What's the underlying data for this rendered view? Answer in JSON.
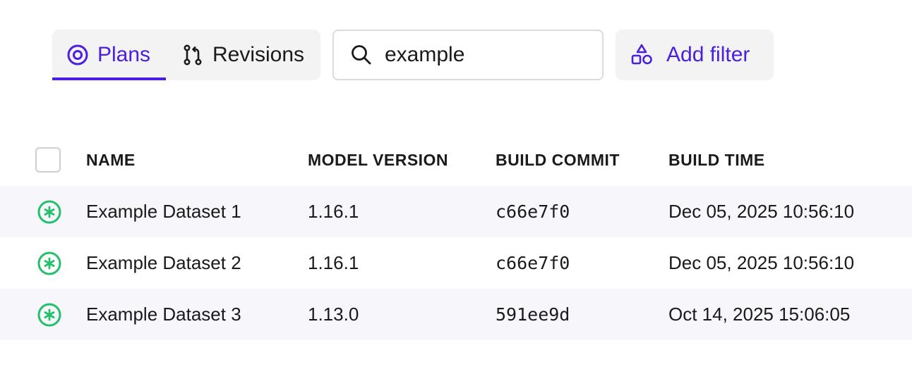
{
  "tabs": [
    {
      "label": "Plans",
      "icon": "target-icon",
      "active": true
    },
    {
      "label": "Revisions",
      "icon": "git-branch-icon",
      "active": false
    }
  ],
  "search": {
    "value": "example",
    "icon": "search-icon"
  },
  "add_filter": {
    "label": "Add filter",
    "icon": "shapes-icon"
  },
  "colors": {
    "accent": "#4a1fe0",
    "status_ok": "#22c06b",
    "row_shade": "#f7f7fb"
  },
  "table": {
    "columns": [
      "NAME",
      "MODEL VERSION",
      "BUILD COMMIT",
      "BUILD TIME"
    ],
    "rows": [
      {
        "name": "Example Dataset 1",
        "model_version": "1.16.1",
        "build_commit": "c66e7f0",
        "build_time": "Dec 05, 2025 10:56:10",
        "status": "asterisk-circle-icon"
      },
      {
        "name": "Example Dataset 2",
        "model_version": "1.16.1",
        "build_commit": "c66e7f0",
        "build_time": "Dec 05, 2025 10:56:10",
        "status": "asterisk-circle-icon"
      },
      {
        "name": "Example Dataset 3",
        "model_version": "1.13.0",
        "build_commit": "591ee9d",
        "build_time": "Oct 14, 2025 15:06:05",
        "status": "asterisk-circle-icon"
      }
    ]
  }
}
